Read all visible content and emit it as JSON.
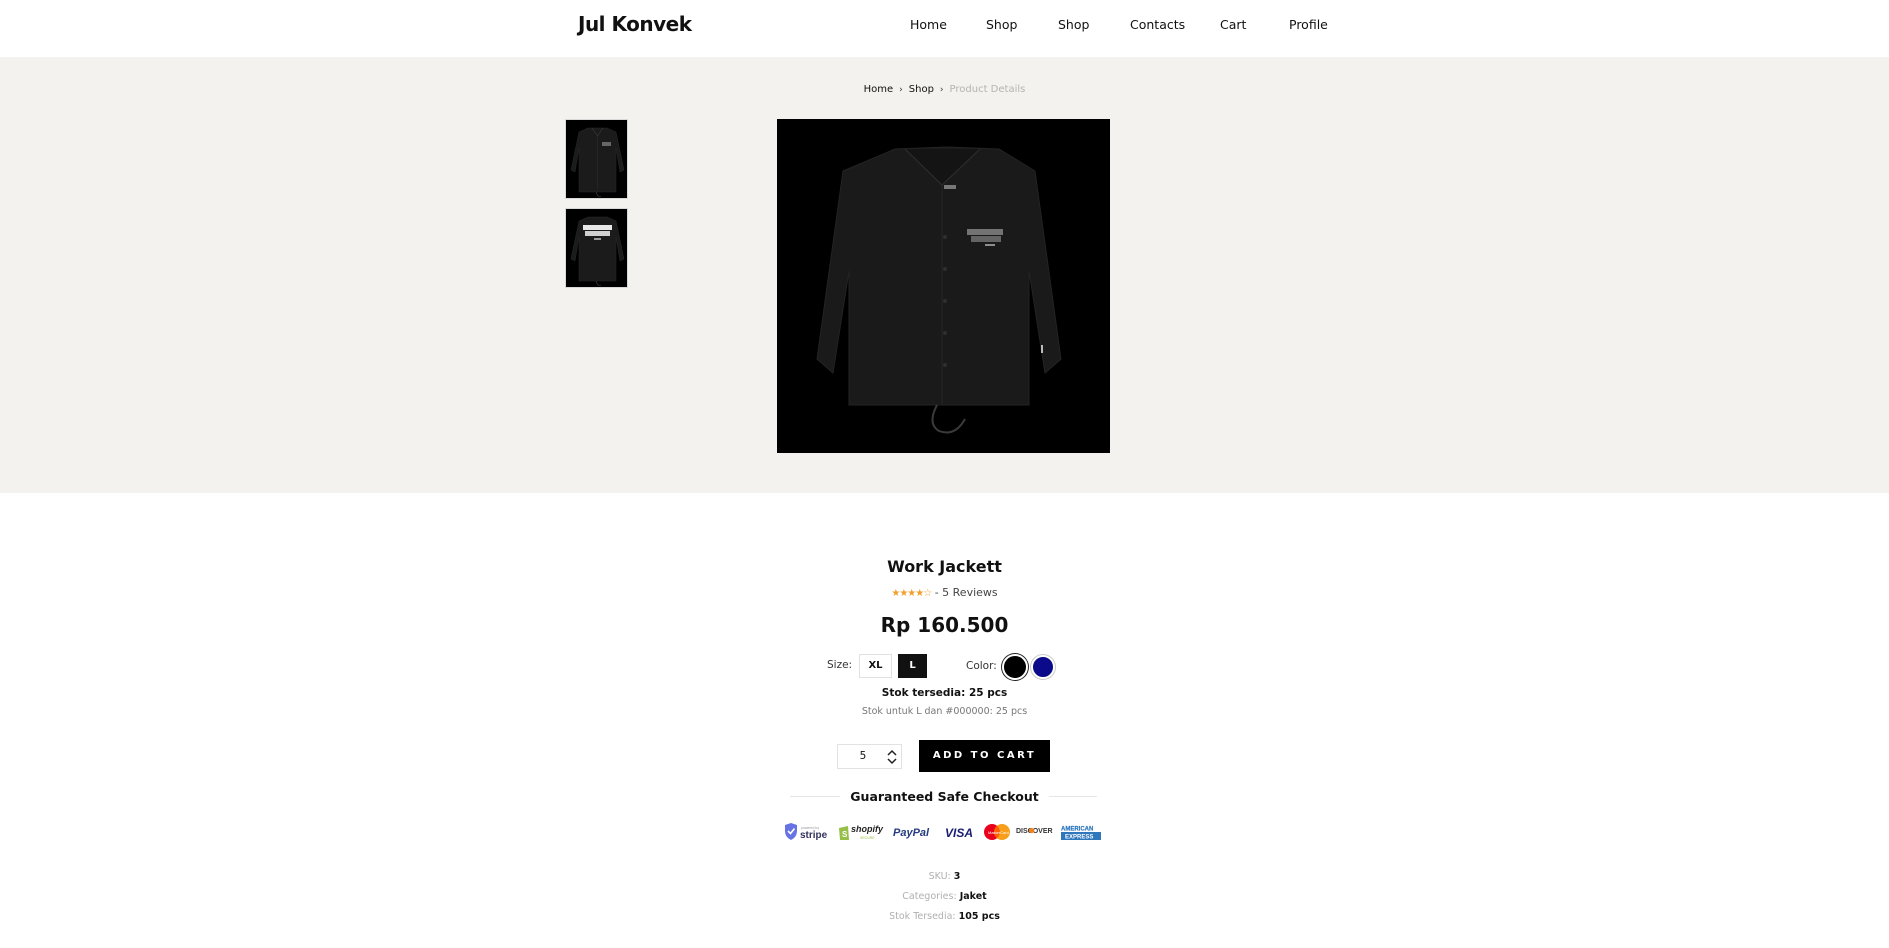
{
  "brand": "Jul Konvek",
  "nav": [
    {
      "label": "Home"
    },
    {
      "label": "Shop"
    },
    {
      "label": "Shop"
    },
    {
      "label": "Contacts"
    },
    {
      "label": "Cart"
    },
    {
      "label": "Profile"
    }
  ],
  "breadcrumb": {
    "home": "Home",
    "shop": "Shop",
    "current": "Product Details"
  },
  "product": {
    "name": "Work Jackett",
    "rating": 4,
    "rating_max": 5,
    "reviews_text": "- 5 Reviews",
    "price": "Rp 160.500",
    "size_label": "Size:",
    "sizes": [
      "XL",
      "L"
    ],
    "selected_size": "L",
    "color_label": "Color:",
    "colors": [
      "#000000",
      "#0a0a8a"
    ],
    "stock_main": "Stok tersedia: 25 pcs",
    "stock_sub": "Stok untuk L dan #000000: 25 pcs",
    "quantity": "5",
    "add_to_cart": "ADD TO CART"
  },
  "checkout": {
    "title": "Guaranteed Safe Checkout",
    "payment_icons": [
      "stripe-icon",
      "shopify-icon",
      "paypal-icon",
      "visa-icon",
      "mastercard-icon",
      "discover-icon",
      "american-express-icon"
    ],
    "labels": {
      "stripe": "stripe",
      "shopify": "shopify",
      "paypal": "PayPal",
      "visa": "VISA",
      "discover": "DISCOVER",
      "amex_top": "AMERICAN",
      "amex_bottom": "EXPRESS"
    }
  },
  "meta": {
    "sku_label": "SKU:",
    "sku": "3",
    "categories_label": "Categories:",
    "categories": "Jaket",
    "stock_label": "Stok Tersedia:",
    "stock": "105 pcs"
  }
}
